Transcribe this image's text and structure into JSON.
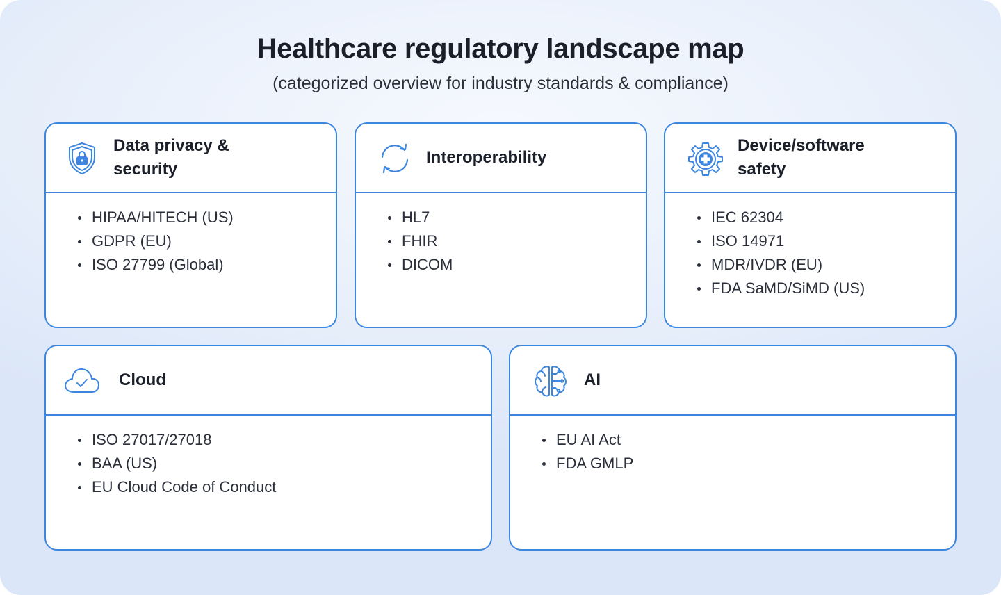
{
  "header": {
    "title": "Healthcare regulatory landscape map",
    "subtitle": "(categorized overview for industry standards & compliance)"
  },
  "colors": {
    "accent": "#3d86e0",
    "text": "#1b1f2a"
  },
  "cards": [
    {
      "title": "Data privacy & security",
      "icon": "shield-lock-icon",
      "items": [
        "HIPAA/HITECH (US)",
        "GDPR (EU)",
        "ISO 27799 (Global)"
      ]
    },
    {
      "title": "Interoperability",
      "icon": "sync-arrows-icon",
      "items": [
        "HL7",
        "FHIR",
        "DICOM"
      ]
    },
    {
      "title": "Device/software safety",
      "icon": "gear-medical-cross-icon",
      "items": [
        "IEC 62304",
        "ISO 14971",
        "MDR/IVDR (EU)",
        "FDA SaMD/SiMD (US)"
      ]
    },
    {
      "title": "Cloud",
      "icon": "cloud-check-icon",
      "items": [
        "ISO 27017/27018",
        "BAA (US)",
        "EU Cloud Code of Conduct"
      ]
    },
    {
      "title": "AI",
      "icon": "brain-circuit-icon",
      "items": [
        "EU AI Act",
        "FDA GMLP"
      ]
    }
  ]
}
